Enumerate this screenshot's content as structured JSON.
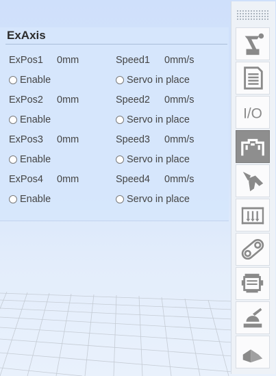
{
  "panel": {
    "title": "ExAxis",
    "axes": [
      {
        "pos_label": "ExPos1",
        "pos_value": "0mm",
        "speed_label": "Speed1",
        "speed_value": "0mm/s",
        "enable_label": "Enable",
        "servo_label": "Servo in place"
      },
      {
        "pos_label": "ExPos2",
        "pos_value": "0mm",
        "speed_label": "Speed2",
        "speed_value": "0mm/s",
        "enable_label": "Enable",
        "servo_label": "Servo in place"
      },
      {
        "pos_label": "ExPos3",
        "pos_value": "0mm",
        "speed_label": "Speed3",
        "speed_value": "0mm/s",
        "enable_label": "Enable",
        "servo_label": "Servo in place"
      },
      {
        "pos_label": "ExPos4",
        "pos_value": "0mm",
        "speed_label": "Speed4",
        "speed_value": "0mm/s",
        "enable_label": "Enable",
        "servo_label": "Servo in place"
      }
    ]
  },
  "toolbar": {
    "icon_color": "#8a8a8a",
    "active_icon_color": "#ffffff",
    "buttons": [
      {
        "icon": "robot-arm-icon",
        "active": false
      },
      {
        "icon": "document-icon",
        "active": false
      },
      {
        "icon": "io-icon",
        "active": false,
        "text": "I/O"
      },
      {
        "icon": "external-axis-icon",
        "active": true
      },
      {
        "icon": "gripper-icon",
        "active": false
      },
      {
        "icon": "conveyor-icon",
        "active": false
      },
      {
        "icon": "belt-track-icon",
        "active": false
      },
      {
        "icon": "motor-icon",
        "active": false
      },
      {
        "icon": "welding-torch-icon",
        "active": false
      },
      {
        "icon": "corner-frame-icon",
        "active": false
      }
    ]
  }
}
